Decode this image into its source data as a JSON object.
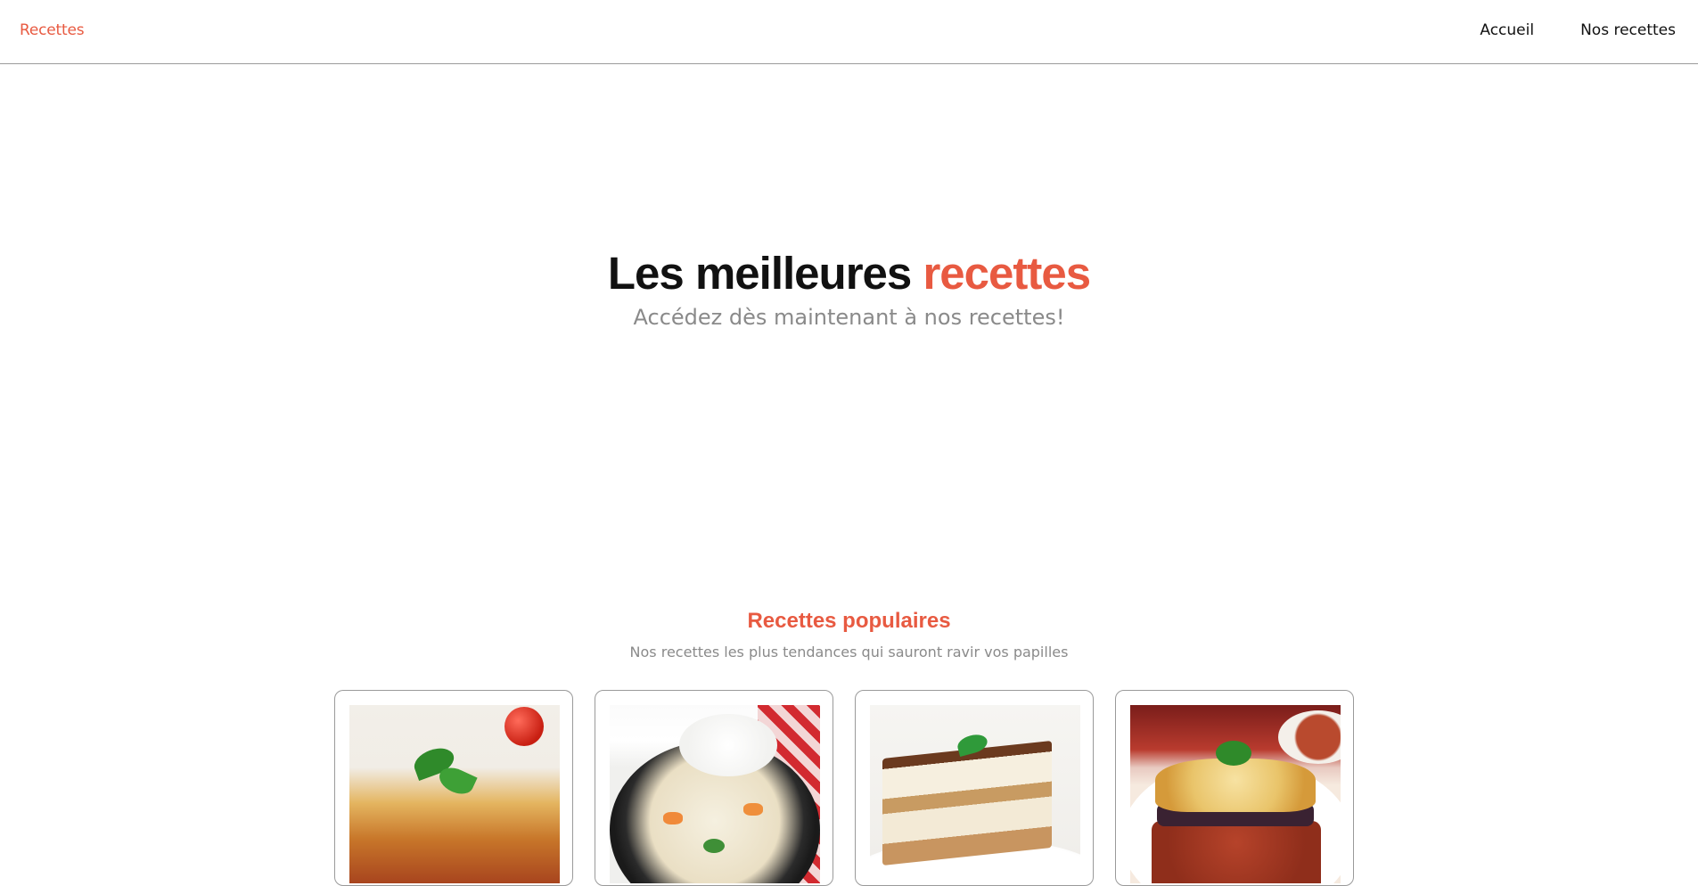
{
  "nav": {
    "brand": "Recettes",
    "links": [
      "Accueil",
      "Nos recettes"
    ]
  },
  "hero": {
    "title_main": "Les meilleures",
    "title_accent": "recettes",
    "subtitle": "Accédez dès maintenant à nos recettes!"
  },
  "popular": {
    "title": "Recettes populaires",
    "subtitle": "Nos recettes les plus tendances qui sauront ravir vos papilles"
  },
  "colors": {
    "accent": "#e85a41",
    "muted": "#8a8a8a",
    "border": "#9a9a9a"
  }
}
